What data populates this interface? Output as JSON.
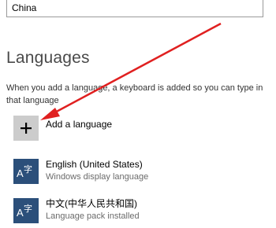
{
  "region": {
    "value": "China"
  },
  "languages_section": {
    "title": "Languages",
    "description": "When you add a language, a keyboard is added so you can type in that language",
    "add_language_label": "Add a language",
    "items": [
      {
        "name": "English (United States)",
        "status": "Windows display language",
        "icon": "language-icon"
      },
      {
        "name": "中文(中华人民共和国)",
        "status": "Language pack installed",
        "icon": "language-icon"
      }
    ]
  },
  "colors": {
    "accent": "#2b4f7a",
    "add_tile": "#cccccc",
    "annotation_arrow": "#e02020"
  }
}
